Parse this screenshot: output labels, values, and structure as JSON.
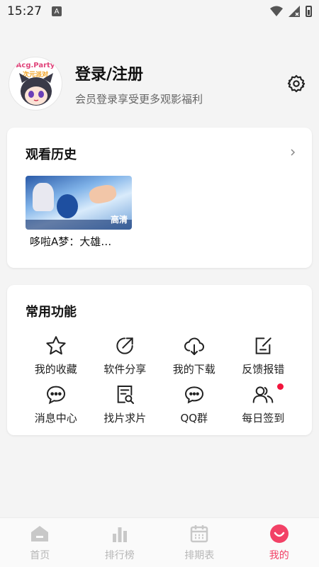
{
  "status_bar": {
    "time": "15:27",
    "notification_icon": "A"
  },
  "profile": {
    "avatar_brand_line1": "Acg.Party",
    "avatar_brand_line2": "次元派对",
    "title": "登录/注册",
    "subtitle": "会员登录享受更多观影福利"
  },
  "history": {
    "title": "观看历史",
    "items": [
      {
        "title": "哆啦A梦：大雄…",
        "thumb_text": "高清"
      }
    ]
  },
  "functions": {
    "title": "常用功能",
    "items": [
      {
        "label": "我的收藏",
        "icon": "star-icon"
      },
      {
        "label": "软件分享",
        "icon": "share-icon"
      },
      {
        "label": "我的下载",
        "icon": "cloud-download-icon"
      },
      {
        "label": "反馈报错",
        "icon": "feedback-icon"
      },
      {
        "label": "消息中心",
        "icon": "chat-bubble-icon"
      },
      {
        "label": "找片求片",
        "icon": "search-document-icon"
      },
      {
        "label": "QQ群",
        "icon": "group-chat-icon"
      },
      {
        "label": "每日签到",
        "icon": "people-icon",
        "badge": true
      }
    ]
  },
  "tabs": [
    {
      "label": "首页",
      "icon": "home-icon",
      "active": false
    },
    {
      "label": "排行榜",
      "icon": "ranking-icon",
      "active": false
    },
    {
      "label": "排期表",
      "icon": "calendar-icon",
      "active": false
    },
    {
      "label": "我的",
      "icon": "profile-smile-icon",
      "active": true
    }
  ],
  "colors": {
    "accent": "#f24166",
    "badge": "#f2143c",
    "inactive_tab": "#b7b7b7"
  }
}
